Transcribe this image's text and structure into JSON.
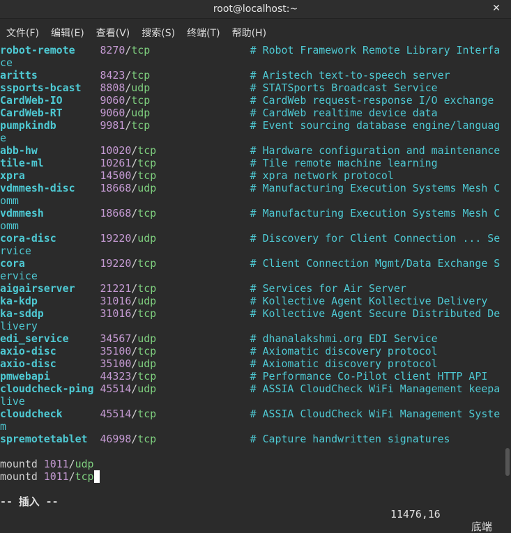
{
  "window": {
    "title": "root@localhost:~"
  },
  "menu": [
    {
      "label": "文件(F)"
    },
    {
      "label": "编辑(E)"
    },
    {
      "label": "查看(V)"
    },
    {
      "label": "搜索(S)"
    },
    {
      "label": "终端(T)"
    },
    {
      "label": "帮助(H)"
    }
  ],
  "lines": [
    {
      "svc": "robot-remote",
      "pad1": "    ",
      "num": "8270",
      "proto": "tcp",
      "pad2": "                ",
      "cmt": "# Robot Framework Remote Library Interfa"
    },
    {
      "cont": "ce"
    },
    {
      "svc": "aritts",
      "pad1": "          ",
      "num": "8423",
      "proto": "tcp",
      "pad2": "                ",
      "cmt": "# Aristech text-to-speech server"
    },
    {
      "svc": "ssports-bcast",
      "pad1": "   ",
      "num": "8808",
      "proto": "udp",
      "pad2": "                ",
      "cmt": "# STATSports Broadcast Service"
    },
    {
      "svc": "CardWeb-IO",
      "pad1": "      ",
      "num": "9060",
      "proto": "tcp",
      "pad2": "                ",
      "cmt": "# CardWeb request-response I/O exchange"
    },
    {
      "svc": "CardWeb-RT",
      "pad1": "      ",
      "num": "9060",
      "proto": "udp",
      "pad2": "                ",
      "cmt": "# CardWeb realtime device data"
    },
    {
      "svc": "pumpkindb",
      "pad1": "       ",
      "num": "9981",
      "proto": "tcp",
      "pad2": "                ",
      "cmt": "# Event sourcing database engine/languag"
    },
    {
      "cont": "e"
    },
    {
      "svc": "abb-hw",
      "pad1": "          ",
      "num": "10020",
      "proto": "tcp",
      "pad2": "               ",
      "cmt": "# Hardware configuration and maintenance"
    },
    {
      "svc": "tile-ml",
      "pad1": "         ",
      "num": "10261",
      "proto": "tcp",
      "pad2": "               ",
      "cmt": "# Tile remote machine learning"
    },
    {
      "svc": "xpra",
      "pad1": "            ",
      "num": "14500",
      "proto": "tcp",
      "pad2": "               ",
      "cmt": "# xpra network protocol"
    },
    {
      "svc": "vdmmesh-disc",
      "pad1": "    ",
      "num": "18668",
      "proto": "udp",
      "pad2": "               ",
      "cmt": "# Manufacturing Execution Systems Mesh C"
    },
    {
      "cont": "omm"
    },
    {
      "svc": "vdmmesh",
      "pad1": "         ",
      "num": "18668",
      "proto": "tcp",
      "pad2": "               ",
      "cmt": "# Manufacturing Execution Systems Mesh C"
    },
    {
      "cont": "omm"
    },
    {
      "svc": "cora-disc",
      "pad1": "       ",
      "num": "19220",
      "proto": "udp",
      "pad2": "               ",
      "cmt": "# Discovery for Client Connection ... Se"
    },
    {
      "cont": "rvice"
    },
    {
      "svc": "cora",
      "pad1": "            ",
      "num": "19220",
      "proto": "tcp",
      "pad2": "               ",
      "cmt": "# Client Connection Mgmt/Data Exchange S"
    },
    {
      "cont": "ervice"
    },
    {
      "svc": "aigairserver",
      "pad1": "    ",
      "num": "21221",
      "proto": "tcp",
      "pad2": "               ",
      "cmt": "# Services for Air Server"
    },
    {
      "svc": "ka-kdp",
      "pad1": "          ",
      "num": "31016",
      "proto": "udp",
      "pad2": "               ",
      "cmt": "# Kollective Agent Kollective Delivery"
    },
    {
      "svc": "ka-sddp",
      "pad1": "         ",
      "num": "31016",
      "proto": "tcp",
      "pad2": "               ",
      "cmt": "# Kollective Agent Secure Distributed De"
    },
    {
      "cont": "livery"
    },
    {
      "svc": "edi_service",
      "pad1": "     ",
      "num": "34567",
      "proto": "udp",
      "pad2": "               ",
      "cmt": "# dhanalakshmi.org EDI Service"
    },
    {
      "svc": "axio-disc",
      "pad1": "       ",
      "num": "35100",
      "proto": "tcp",
      "pad2": "               ",
      "cmt": "# Axiomatic discovery protocol"
    },
    {
      "svc": "axio-disc",
      "pad1": "       ",
      "num": "35100",
      "proto": "udp",
      "pad2": "               ",
      "cmt": "# Axiomatic discovery protocol"
    },
    {
      "svc": "pmwebapi",
      "pad1": "        ",
      "num": "44323",
      "proto": "tcp",
      "pad2": "               ",
      "cmt": "# Performance Co-Pilot client HTTP API"
    },
    {
      "svc": "cloudcheck-ping",
      "pad1": " ",
      "num": "45514",
      "proto": "udp",
      "pad2": "               ",
      "cmt": "# ASSIA CloudCheck WiFi Management keepa"
    },
    {
      "cont": "live"
    },
    {
      "svc": "cloudcheck",
      "pad1": "      ",
      "num": "45514",
      "proto": "tcp",
      "pad2": "               ",
      "cmt": "# ASSIA CloudCheck WiFi Management Syste"
    },
    {
      "cont": "m"
    },
    {
      "svc": "spremotetablet",
      "pad1": "  ",
      "num": "46998",
      "proto": "tcp",
      "pad2": "               ",
      "cmt": "# Capture handwritten signatures"
    },
    {
      "blank": ""
    },
    {
      "plain": "mountd",
      "pad1": " ",
      "num": "1011",
      "proto": "udp"
    },
    {
      "plain": "mountd",
      "pad1": " ",
      "num": "1011",
      "proto": "tcp",
      "cursor": " "
    }
  ],
  "status": {
    "mode": "-- 插入 --",
    "position": "11476,16",
    "where": "底端"
  }
}
